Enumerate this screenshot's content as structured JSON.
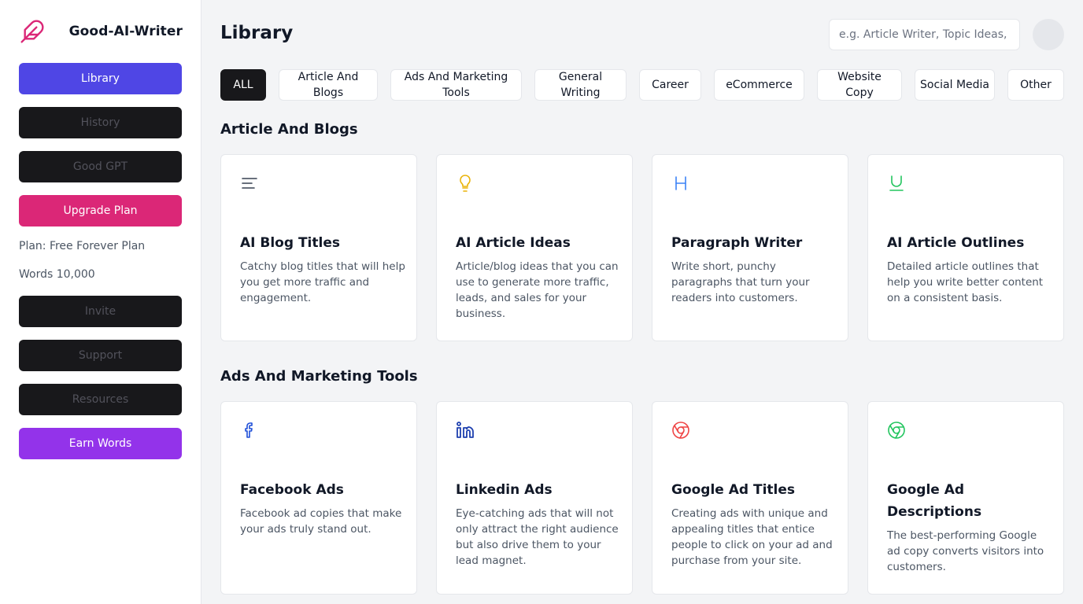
{
  "brand": {
    "name": "Good-AI-Writer",
    "logo_icon": "feather-icon",
    "accent": "#db2777"
  },
  "sidebar": {
    "library": "Library",
    "history": "History",
    "good_gpt": "Good GPT",
    "upgrade": "Upgrade Plan",
    "plan": "Plan: Free Forever Plan",
    "words": "Words 10,000",
    "invite": "Invite",
    "support": "Support",
    "resources": "Resources",
    "earn": "Earn Words"
  },
  "header": {
    "title": "Library",
    "search_placeholder": "e.g. Article Writer, Topic Ideas, etc."
  },
  "filters": [
    "ALL",
    "Article And Blogs",
    "Ads And Marketing Tools",
    "General Writing",
    "Career",
    "eCommerce",
    "Website Copy",
    "Social Media",
    "Other"
  ],
  "sections": [
    {
      "title": "Article And Blogs",
      "cards": [
        {
          "icon": "align-left-icon",
          "color": "#374151",
          "title": "AI Blog Titles",
          "desc": "Catchy blog titles that will help you get more traffic and engagement."
        },
        {
          "icon": "lightbulb-icon",
          "color": "#eab308",
          "title": "AI Article Ideas",
          "desc": "Article/blog ideas that you can use to generate more traffic, leads, and sales for your business."
        },
        {
          "icon": "heading-icon",
          "color": "#3b82f6",
          "title": "Paragraph Writer",
          "desc": "Write short, punchy paragraphs that turn your readers into customers."
        },
        {
          "icon": "underline-icon",
          "color": "#22c55e",
          "title": "AI Article Outlines",
          "desc": "Detailed article outlines that help you write better content on a consistent basis."
        }
      ]
    },
    {
      "title": "Ads And Marketing Tools",
      "cards": [
        {
          "icon": "facebook-icon",
          "color": "#1d4ed8",
          "title": "Facebook Ads",
          "desc": "Facebook ad copies that make your ads truly stand out."
        },
        {
          "icon": "linkedin-icon",
          "color": "#1e40af",
          "title": "Linkedin Ads",
          "desc": "Eye-catching ads that will not only attract the right audience but also drive them to your lead magnet."
        },
        {
          "icon": "chrome-icon",
          "color": "#ef4444",
          "title": "Google Ad Titles",
          "desc": "Creating ads with unique and appealing titles that entice people to click on your ad and purchase from your site."
        },
        {
          "icon": "chrome-icon",
          "color": "#22c55e",
          "title": "Google Ad Descriptions",
          "desc": "The best-performing Google ad copy converts visitors into customers."
        }
      ]
    }
  ]
}
